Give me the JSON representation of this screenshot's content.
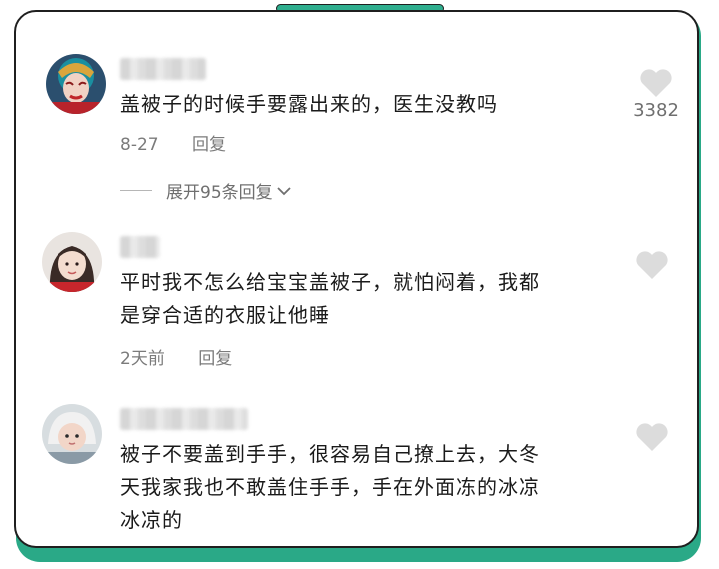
{
  "comments": [
    {
      "text": "盖被子的时候手要露出来的，医生没教吗",
      "date": "8-27",
      "reply_label": "回复",
      "likes": "3382",
      "expand_label": "展开95条回复"
    },
    {
      "text": "平时我不怎么给宝宝盖被子，就怕闷着，我都\n是穿合适的衣服让他睡",
      "date": "2天前",
      "reply_label": "回复"
    },
    {
      "text": "被子不要盖到手手，很容易自己撩上去，大冬\n天我家我也不敢盖住手手，手在外面冻的冰凉\n冰凉的"
    }
  ],
  "colors": {
    "accent": "#2aa987",
    "text": "#1a1a1a",
    "meta": "#7b7b7b",
    "like": "#dcdcdc"
  },
  "icons": {
    "like": "heart-icon",
    "expand": "chevron-down-icon"
  }
}
